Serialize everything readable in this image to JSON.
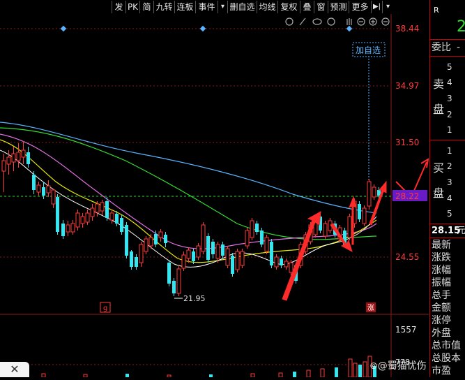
{
  "toolbar": {
    "items": [
      "发",
      "PK",
      "简",
      "九转",
      "连板",
      "事件",
      "▾",
      "删自选",
      "均线",
      "复权",
      "叠",
      "窗",
      "预测",
      "更多",
      "▶|",
      "▾"
    ]
  },
  "chart": {
    "price_labels": [
      "38.44",
      "34.97",
      "31.50",
      "28.22",
      "24.55"
    ],
    "current_price": "28.22",
    "low_label": "21.95",
    "add_watchlist": "加自选",
    "tag_left": "g",
    "tag_right": "涨",
    "volume_label": "1557",
    "volume_sub": "778"
  },
  "sidebar": {
    "top_letter": "R",
    "top_value": "2",
    "wei_bi": "委比",
    "wei_bi_unit": "-",
    "sell_label_1": "卖",
    "sell_label_2": "盘",
    "buy_label_1": "买",
    "buy_label_2": "盘",
    "sell_levels": [
      "5",
      "4",
      "3",
      "2",
      "1"
    ],
    "buy_levels": [
      "1",
      "2",
      "3",
      "4",
      "5"
    ],
    "last_price": "28.15",
    "last_unit": "元",
    "stats": [
      "最新",
      "涨跌",
      "涨幅",
      "振幅",
      "总手",
      "金额",
      "涨停",
      "外盘",
      "总市值",
      "总股本",
      "市盈"
    ]
  },
  "watermark": "⊚@蜀猫忧伤",
  "close": "✕",
  "colors": {
    "up": "#ff3b3b",
    "down": "#33e6f0",
    "ma1": "#ffffff",
    "ma2": "#e8e800",
    "ma3": "#e070e0",
    "ma4": "#33dd33",
    "ma5": "#5ab4ff",
    "accent": "#6a1bc8"
  }
}
